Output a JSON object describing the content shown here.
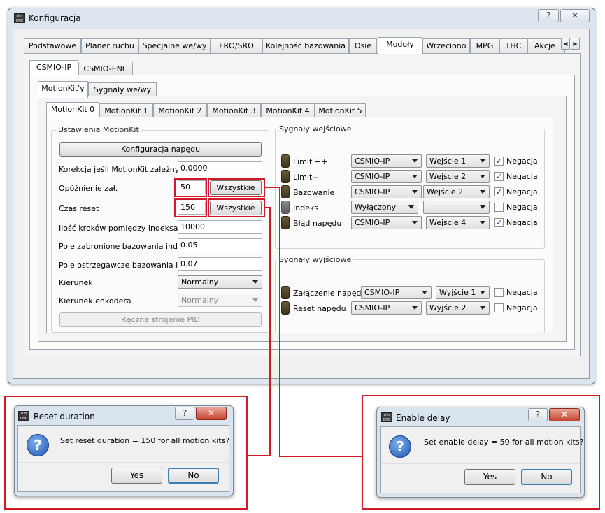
{
  "window": {
    "title": "Konfiguracja",
    "help_btn": "?",
    "close_btn": "✕",
    "icon_text": "sim\nCNC"
  },
  "main_tabs": [
    "Podstawowe",
    "Planer ruchu",
    "Specjalne we/wy",
    "FRO/SRO",
    "Kolejność bazowania",
    "Osie",
    "Moduły",
    "Wrzeciono",
    "MPG",
    "THC",
    "Akcje"
  ],
  "device_tabs": [
    "CSMIO-IP",
    "CSMIO-ENC"
  ],
  "sub_tabs": [
    "MotionKit'y",
    "Sygnały we/wy"
  ],
  "kit_tabs": [
    "MotionKit 0",
    "MotionKit 1",
    "MotionKit 2",
    "MotionKit 3",
    "MotionKit 4",
    "MotionKit 5"
  ],
  "settings": {
    "title": "Ustawienia MotionKit",
    "drive_config_btn": "Konfiguracja napędu",
    "rows": [
      {
        "label": "Korekcja jeśli MotionKit zależny",
        "value": "0.0000"
      },
      {
        "label": "Opóźnienie zał.",
        "value": "50",
        "btn": "Wszystkie"
      },
      {
        "label": "Czas reset",
        "value": "150",
        "btn": "Wszystkie"
      },
      {
        "label": "Ilość kroków pomiędzy indeksami",
        "value": "10000"
      },
      {
        "label": "Pole zabronione bazowania ind.",
        "value": "0.05"
      },
      {
        "label": "Pole ostrzegawcze bazowania ind.",
        "value": "0.07"
      },
      {
        "label": "Kierunek",
        "value": "Normalny"
      },
      {
        "label": "Kierunek enkodera",
        "value": "Normalny"
      }
    ],
    "pid_btn": "Ręczne strojenie PID"
  },
  "inputs": {
    "title": "Sygnały wejściowe",
    "rows": [
      {
        "name": "Limit ++",
        "device": "CSMIO-IP",
        "pin": "Wejście 1",
        "neg": true
      },
      {
        "name": "Limit--",
        "device": "CSMIO-IP",
        "pin": "Wejście 2",
        "neg": true
      },
      {
        "name": "Bazowanie",
        "device": "CSMIO-IP",
        "pin": "Wejście 2",
        "neg": true
      },
      {
        "name": "Indeks",
        "device": "Wyłączony",
        "pin": "",
        "neg": false
      },
      {
        "name": "Błąd napędu",
        "device": "CSMIO-IP",
        "pin": "Wejście 4",
        "neg": true
      }
    ],
    "neg_label": "Negacja"
  },
  "outputs": {
    "title": "Sygnały wyjściowe",
    "rows": [
      {
        "name": "Załączenie napędu",
        "device": "CSMIO-IP",
        "pin": "Wyjście 1",
        "neg": false
      },
      {
        "name": "Reset napędu",
        "device": "CSMIO-IP",
        "pin": "Wyjście 2",
        "neg": false
      }
    ],
    "neg_label": "Negacja"
  },
  "dialog_reset": {
    "title": "Reset duration",
    "message": "Set reset duration = 150 for all motion kits?",
    "yes": "Yes",
    "no": "No"
  },
  "dialog_enable": {
    "title": "Enable delay",
    "message": "Set enable delay = 50 for all motion kits?",
    "yes": "Yes",
    "no": "No"
  }
}
